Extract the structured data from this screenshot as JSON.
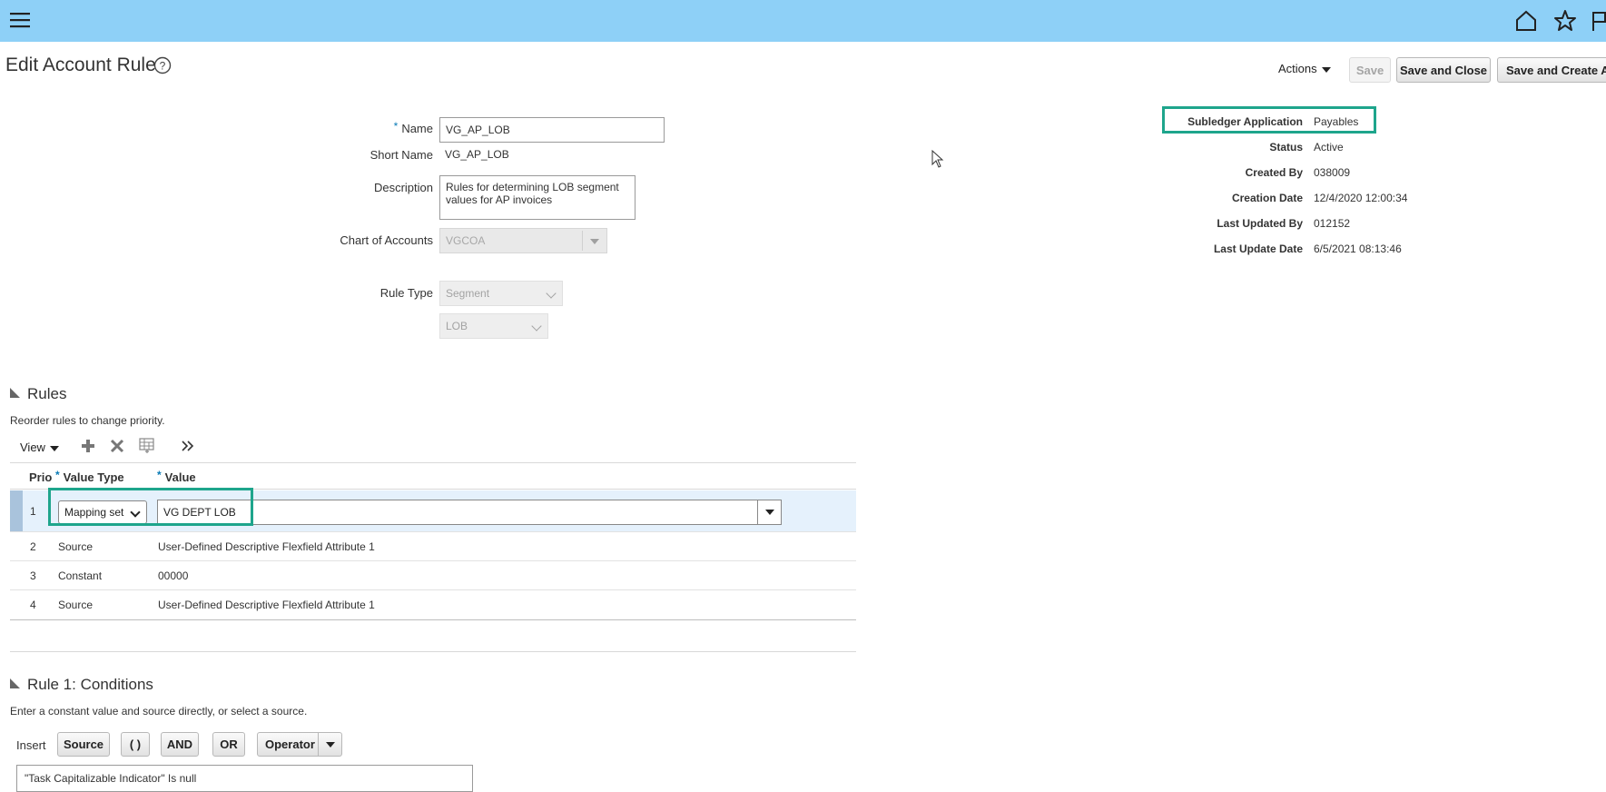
{
  "header": {
    "icons": [
      "menu-icon",
      "home-icon",
      "star-icon",
      "flag-icon"
    ],
    "bg_color": "#8ed0f7"
  },
  "page": {
    "title": "Edit Account Rule",
    "actions_label": "Actions",
    "save_label": "Save",
    "save_close_label": "Save and Close",
    "save_create_label": "Save and Create An"
  },
  "form": {
    "name_label": "Name",
    "name_value": "VG_AP_LOB",
    "short_name_label": "Short Name",
    "short_name_value": "VG_AP_LOB",
    "description_label": "Description",
    "description_value": "Rules for determining LOB segment values for AP invoices",
    "coa_label": "Chart of Accounts",
    "coa_value": "VGCOA",
    "rule_type_label": "Rule Type",
    "rule_type_value": "Segment",
    "segment_value": "LOB"
  },
  "info": {
    "subledger_label": "Subledger Application",
    "subledger_value": "Payables",
    "status_label": "Status",
    "status_value": "Active",
    "created_by_label": "Created By",
    "created_by_value": "038009",
    "creation_date_label": "Creation Date",
    "creation_date_value": "12/4/2020 12:00:34",
    "last_updated_by_label": "Last Updated By",
    "last_updated_by_value": "012152",
    "last_update_date_label": "Last Update Date",
    "last_update_date_value": "6/5/2021 08:13:46"
  },
  "rules": {
    "heading": "Rules",
    "hint": "Reorder rules to change priority.",
    "view_label": "View",
    "columns": {
      "prio": "Prio",
      "value_type": "Value Type",
      "value": "Value"
    },
    "rows": [
      {
        "prio": "1",
        "value_type": "Mapping set",
        "value": "VG DEPT LOB"
      },
      {
        "prio": "2",
        "value_type": "Source",
        "value": "User-Defined Descriptive Flexfield Attribute 1"
      },
      {
        "prio": "3",
        "value_type": "Constant",
        "value": "00000"
      },
      {
        "prio": "4",
        "value_type": "Source",
        "value": "User-Defined Descriptive Flexfield Attribute 1"
      }
    ]
  },
  "conditions": {
    "heading": "Rule 1: Conditions",
    "hint": "Enter a constant value and source directly, or select a source.",
    "insert_label": "Insert",
    "source_label": "Source",
    "paren_label": "( )",
    "and_label": "AND",
    "or_label": "OR",
    "operator_label": "Operator",
    "condition_value": "\"Task Capitalizable Indicator\" Is null"
  },
  "accent_color": "#1ea58c"
}
